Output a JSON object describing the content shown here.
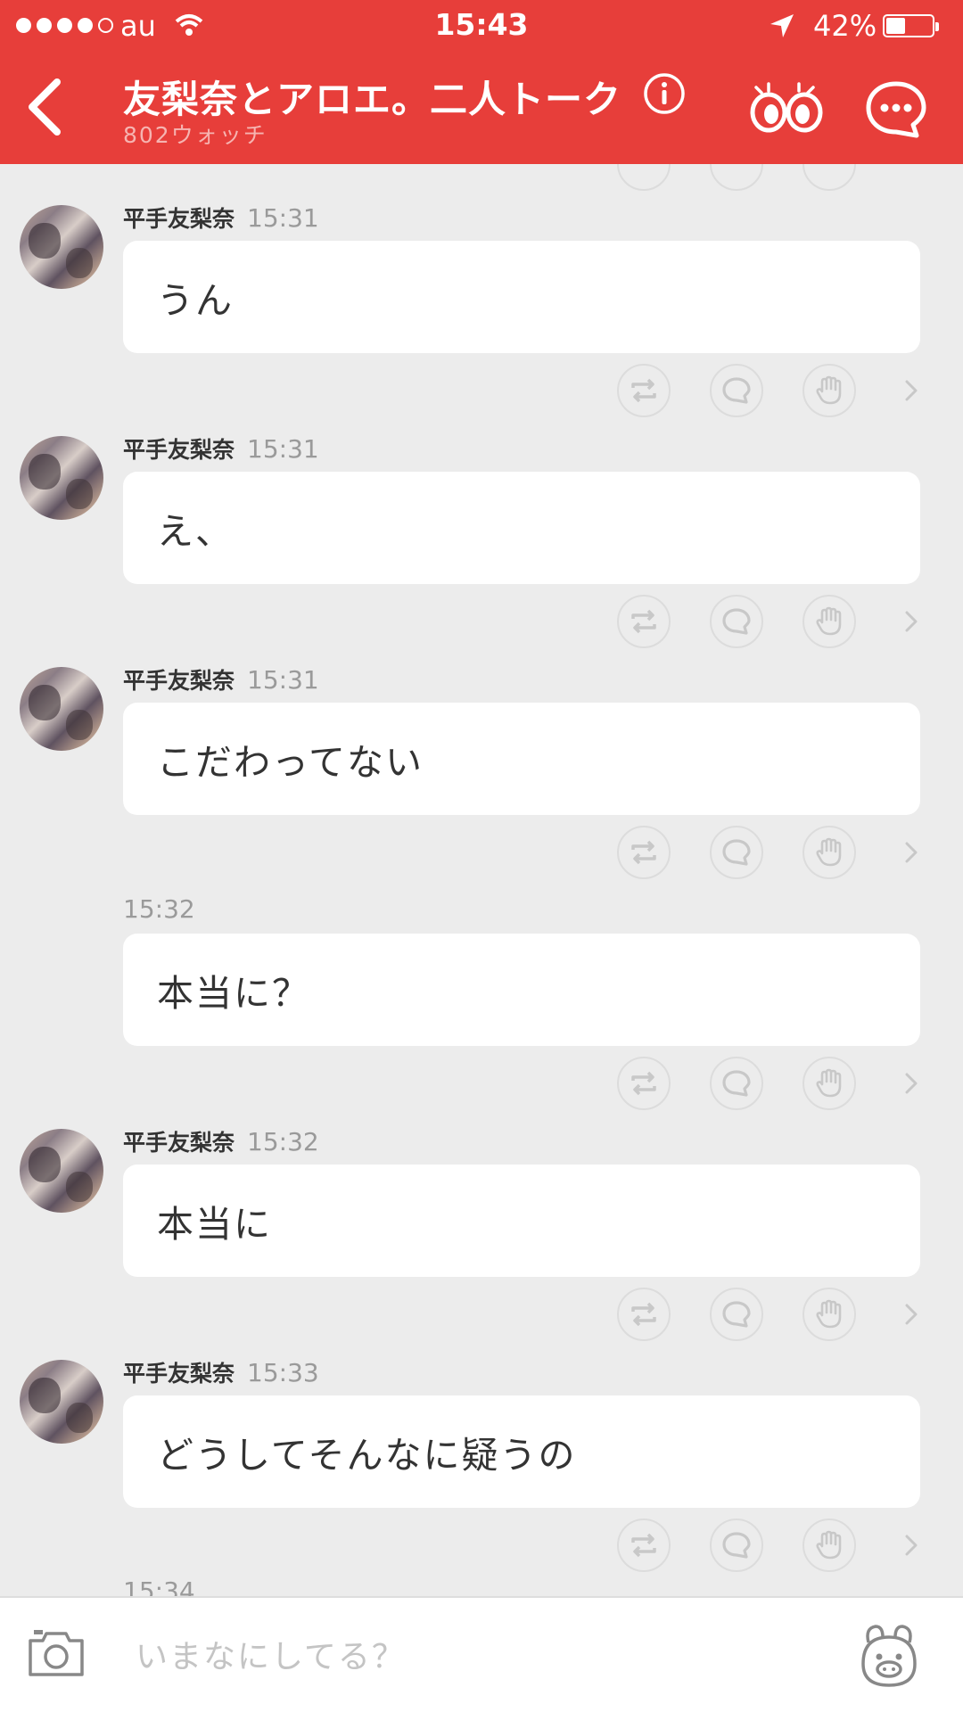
{
  "status_bar": {
    "carrier": "au",
    "time": "15:43",
    "battery": "42%",
    "battery_level": 0.42
  },
  "header": {
    "title": "友梨奈とアロエ。二人トーク",
    "subtitle": "802ウォッチ",
    "icons": [
      "back-icon",
      "info-icon",
      "watch-eyes-icon",
      "chat-menu-icon"
    ]
  },
  "messages": [
    {
      "sender": "平手友梨奈",
      "time": "15:31",
      "text": "うん"
    },
    {
      "sender": "平手友梨奈",
      "time": "15:31",
      "text": "え、"
    },
    {
      "sender": "平手友梨奈",
      "time": "15:31",
      "text": "こだわってない"
    },
    {
      "sender": "",
      "time": "15:32",
      "text": "本当に？"
    },
    {
      "sender": "平手友梨奈",
      "time": "15:32",
      "text": "本当に"
    },
    {
      "sender": "平手友梨奈",
      "time": "15:33",
      "text": "どうしてそんなに疑うの"
    }
  ],
  "next_time": "15:34",
  "message_actions": [
    "repost-icon",
    "comment-icon",
    "cheer-hand-icon",
    "chevron-right-icon"
  ],
  "input": {
    "placeholder": "いまなにしてる？",
    "value": ""
  },
  "colors": {
    "header_bg": "#e73e3a",
    "chat_bg": "#ececec",
    "bubble_bg": "#ffffff"
  }
}
